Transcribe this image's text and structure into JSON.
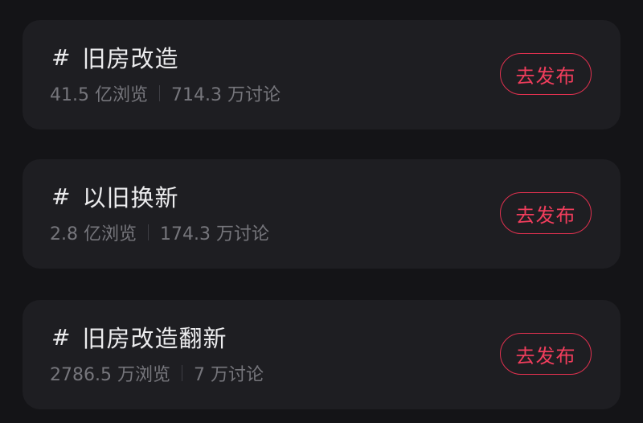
{
  "topics": [
    {
      "hash_symbol": "#",
      "title": "旧房改造",
      "views": "41.5 亿浏览",
      "discussions": "714.3 万讨论",
      "button_label": "去发布"
    },
    {
      "hash_symbol": "#",
      "title": "以旧换新",
      "views": "2.8 亿浏览",
      "discussions": "174.3 万讨论",
      "button_label": "去发布"
    },
    {
      "hash_symbol": "#",
      "title": "旧房改造翻新",
      "views": "2786.5 万浏览",
      "discussions": "7 万讨论",
      "button_label": "去发布"
    }
  ],
  "colors": {
    "background": "#141417",
    "card": "#1e1e22",
    "title_text": "#ececee",
    "stats_text": "#76767c",
    "accent": "#f03d5c"
  }
}
